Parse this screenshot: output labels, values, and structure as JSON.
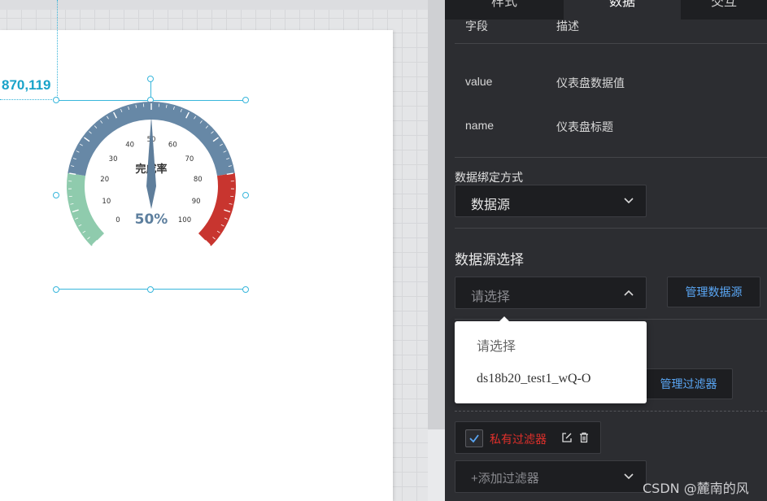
{
  "canvas": {
    "coord_label": "870,119",
    "gauge": {
      "title": "完成率",
      "value_text": "50%",
      "value": 50,
      "min": 0,
      "max": 100,
      "tick_labels": [
        "0",
        "10",
        "20",
        "30",
        "40",
        "50",
        "60",
        "70",
        "80",
        "90",
        "100"
      ],
      "colors": {
        "low": "#8fcbad",
        "mid": "#6788a6",
        "high": "#c8352f",
        "pointer": "#5f7e9b",
        "value_text": "#5d7f9e"
      }
    }
  },
  "panel": {
    "tabs": [
      {
        "label": "样式",
        "active": false
      },
      {
        "label": "数据",
        "active": true
      },
      {
        "label": "交互",
        "active": false
      }
    ],
    "fields_header": {
      "key": "字段",
      "desc": "描述"
    },
    "fields": [
      {
        "key": "value",
        "desc": "仪表盘数据值"
      },
      {
        "key": "name",
        "desc": "仪表盘标题"
      }
    ],
    "binding_label": "数据绑定方式",
    "binding_value": "数据源",
    "datasource_title": "数据源选择",
    "datasource_placeholder": "请选择",
    "manage_datasource": "管理数据源",
    "dropdown_options": [
      "请选择",
      "ds18b20_test1_wQ-O"
    ],
    "manage_filter": "管理过滤器",
    "private_filter": "私有过滤器",
    "add_filter": "+添加过滤器",
    "accent_color": "#5aa7f5",
    "danger_color": "#e0302b"
  },
  "watermark": "CSDN @麓南的风"
}
